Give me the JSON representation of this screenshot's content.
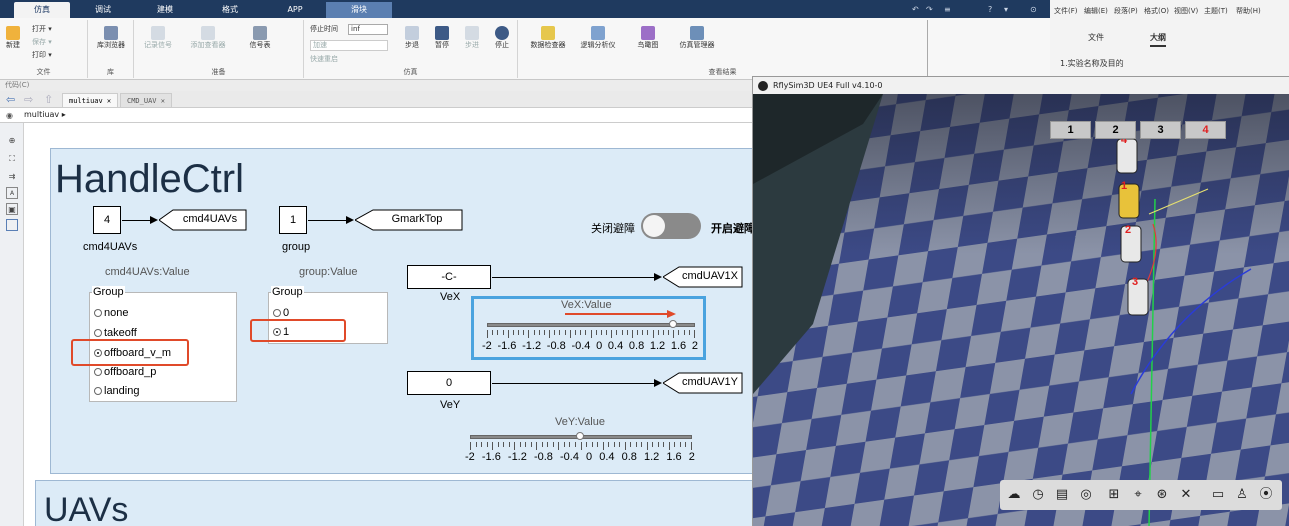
{
  "ribbon": {
    "tabs": [
      "仿真",
      "调试",
      "建模",
      "格式",
      "APP",
      "滑块"
    ],
    "quick_access": [
      "↶",
      "↷",
      "≡",
      "?",
      "▾",
      "⊙"
    ],
    "sections": {
      "file": {
        "label": "文件",
        "new": "新建",
        "open": "打开",
        "save": "保存",
        "print": "打印"
      },
      "library": {
        "label": "库",
        "browser": "库浏览器"
      },
      "prepare": {
        "label": "准备",
        "log_signal": "记录信号",
        "add_viewer": "添加查看器",
        "signal_table": "信号表"
      },
      "simulate": {
        "label": "仿真",
        "stop_time_label": "停止时间",
        "stop_time_value": "inf",
        "accel": "加速",
        "fast_restart": "快速重启",
        "step_back": "步退",
        "pause": "暂停",
        "step_forward": "步进",
        "stop": "停止"
      },
      "review": {
        "label": "查看结果",
        "data_inspector": "数据检查器",
        "logic_analyzer": "逻辑分析仪",
        "birds_eye": "鸟瞰图",
        "sim_manager": "仿真管理器"
      }
    }
  },
  "right_panel": {
    "menu": [
      "文件(F)",
      "编辑(E)",
      "段落(P)",
      "格式(O)",
      "视图(V)",
      "主题(T)",
      "帮助(H)"
    ],
    "tabs": [
      "文件",
      "大纲"
    ],
    "outline_item": "1.实验名称及目的"
  },
  "codepath": "代码(C)",
  "doc_tabs": [
    "multiuav",
    "CMD_UAV"
  ],
  "breadcrumb": "multiuav ▸",
  "model": {
    "area1_title": "HandleCtrl",
    "area2_title": "UAVs",
    "const_cmd": {
      "value": "4",
      "name": "cmd4UAVs",
      "goto": "cmd4UAVs"
    },
    "const_group": {
      "value": "1",
      "name": "group",
      "goto": "GmarkTop"
    },
    "const_vex": {
      "value": "-C-",
      "name": "VeX",
      "goto": "cmdUAV1X"
    },
    "const_vey": {
      "value": "0",
      "name": "VeY",
      "goto": "cmdUAV1Y"
    },
    "cmd_panel": {
      "title": "cmd4UAVs:Value",
      "legend": "Group",
      "options": [
        "none",
        "takeoff",
        "offboard_v_m",
        "offboard_p",
        "landing"
      ],
      "selected_index": 2
    },
    "group_panel": {
      "title": "group:Value",
      "legend": "Group",
      "options": [
        "0",
        "1"
      ],
      "selected_index": 1
    },
    "vex_slider": {
      "title": "VeX:Value",
      "ticks": [
        "-2",
        "-1.6",
        "-1.2",
        "-0.8",
        "-0.4",
        "0",
        "0.4",
        "0.8",
        "1.2",
        "1.6",
        "2"
      ],
      "value": 1.6,
      "min": -2,
      "max": 2
    },
    "vey_slider": {
      "title": "VeY:Value",
      "ticks": [
        "-2",
        "-1.6",
        "-1.2",
        "-0.8",
        "-0.4",
        "0",
        "0.4",
        "0.8",
        "1.2",
        "1.6",
        "2"
      ],
      "value": 0,
      "min": -2,
      "max": 2
    },
    "toggle": {
      "off_label": "关闭避障",
      "on_label": "开启避障"
    }
  },
  "sim": {
    "title": "RflySim3D UE4 Full v4.10-0",
    "view_buttons": [
      "1",
      "2",
      "3",
      "4"
    ],
    "active_button": "4",
    "uav_labels": [
      "4",
      "1",
      "2",
      "3"
    ],
    "toolbar_icons": [
      "cloud-icon",
      "clock-icon",
      "layers-icon",
      "target-icon",
      "grid-icon",
      "location-icon",
      "compass-icon",
      "trash-icon",
      "camera-icon",
      "person-add-icon",
      "screenshot-icon"
    ]
  },
  "colors": {
    "ribbon": "#1f3a5f",
    "highlight": "#e04a2a",
    "slider_box": "#4aa3df",
    "area": "#dcebf7"
  }
}
